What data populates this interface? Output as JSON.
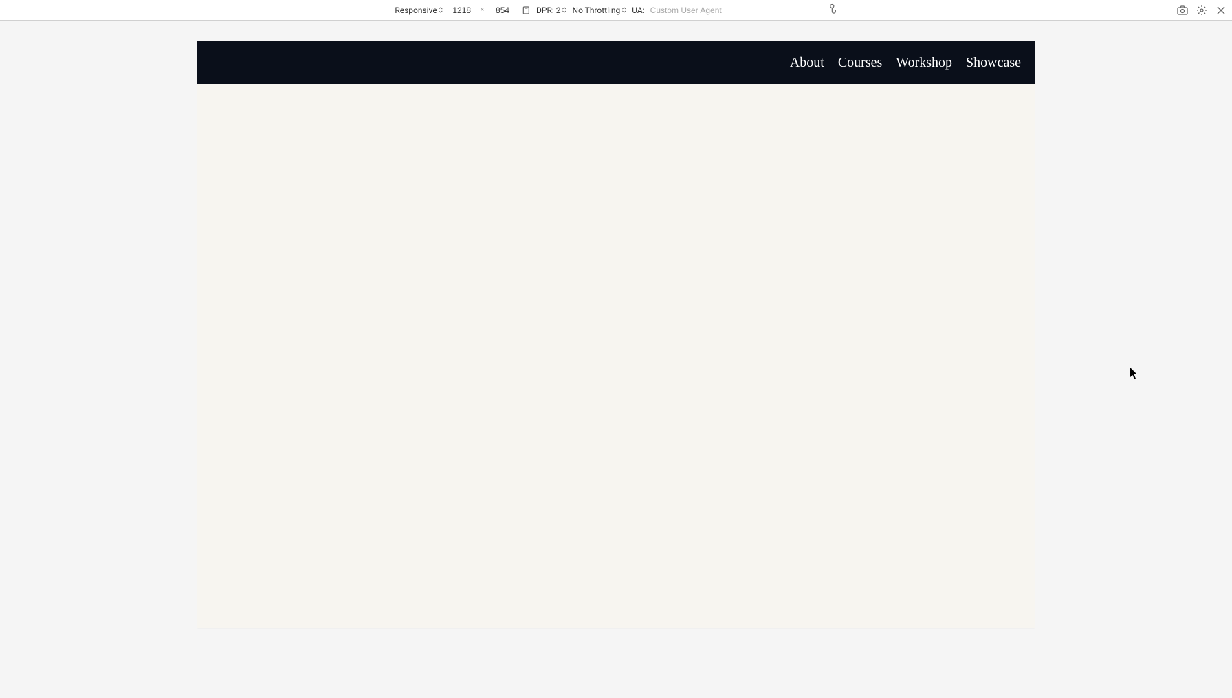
{
  "devtools": {
    "device_mode": "Responsive",
    "width": "1218",
    "height": "854",
    "dpr_label": "DPR: 2",
    "throttling": "No Throttling",
    "ua_label": "UA:",
    "ua_placeholder": "Custom User Agent"
  },
  "site": {
    "nav": {
      "items": [
        {
          "label": "About"
        },
        {
          "label": "Courses"
        },
        {
          "label": "Workshop"
        },
        {
          "label": "Showcase"
        }
      ]
    }
  }
}
